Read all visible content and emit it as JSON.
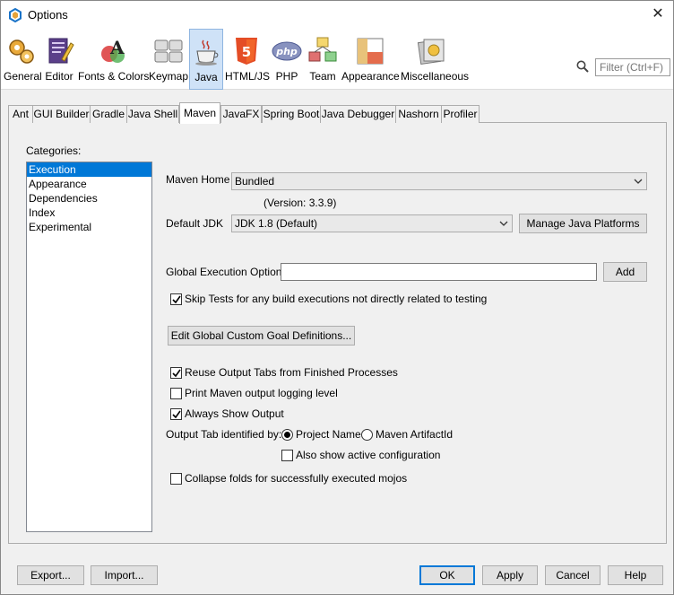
{
  "window": {
    "title": "Options",
    "close_glyph": "✕"
  },
  "toolbar": {
    "categories": [
      {
        "label": "General",
        "icon": "gears-icon"
      },
      {
        "label": "Editor",
        "icon": "editor-icon"
      },
      {
        "label": "Fonts & Colors",
        "icon": "fonts-colors-icon"
      },
      {
        "label": "Keymap",
        "icon": "keyboard-icon"
      },
      {
        "label": "Java",
        "icon": "java-cup-icon"
      },
      {
        "label": "HTML/JS",
        "icon": "html5-icon"
      },
      {
        "label": "PHP",
        "icon": "php-icon"
      },
      {
        "label": "Team",
        "icon": "team-icon"
      },
      {
        "label": "Appearance",
        "icon": "appearance-icon"
      },
      {
        "label": "Miscellaneous",
        "icon": "miscellaneous-icon"
      }
    ],
    "selected": "Java",
    "search_placeholder": "Filter (Ctrl+F)"
  },
  "tabs": [
    "Ant",
    "GUI Builder",
    "Gradle",
    "Java Shell",
    "Maven",
    "JavaFX",
    "Spring Boot",
    "Java Debugger",
    "Nashorn",
    "Profiler"
  ],
  "active_tab": "Maven",
  "maven": {
    "categories_label": "Categories:",
    "categories": [
      "Execution",
      "Appearance",
      "Dependencies",
      "Index",
      "Experimental"
    ],
    "selected_category": "Execution",
    "maven_home_label": "Maven Home :",
    "maven_home_value": "Bundled",
    "version_text": "(Version: 3.3.9)",
    "default_jdk_label": "Default JDK",
    "default_jdk_value": "JDK 1.8 (Default)",
    "manage_platforms_label": "Manage Java Platforms",
    "global_exec_label": "Global Execution Options:",
    "global_exec_value": "",
    "add_label": "Add",
    "skip_tests_label": "Skip Tests for any build executions not directly related to testing",
    "skip_tests_checked": true,
    "edit_goals_label": "Edit Global Custom Goal Definitions...",
    "reuse_tabs_label": "Reuse Output Tabs from Finished Processes",
    "reuse_tabs_checked": true,
    "print_logging_label": "Print Maven output logging level",
    "print_logging_checked": false,
    "always_show_label": "Always Show Output",
    "always_show_checked": true,
    "output_tab_label": "Output Tab identified by:",
    "radio_project_name": "Project Name",
    "radio_artifact_id": "Maven ArtifactId",
    "radio_selected": "Project Name",
    "also_show_label": "Also show active configuration",
    "also_show_checked": false,
    "collapse_folds_label": "Collapse folds for successfully executed mojos",
    "collapse_folds_checked": false
  },
  "footer": {
    "export_label": "Export...",
    "import_label": "Import...",
    "ok_label": "OK",
    "apply_label": "Apply",
    "cancel_label": "Cancel",
    "help_label": "Help"
  },
  "colors": {
    "selection": "#0078d7",
    "toolbar_selected": "#cfe2f7"
  }
}
